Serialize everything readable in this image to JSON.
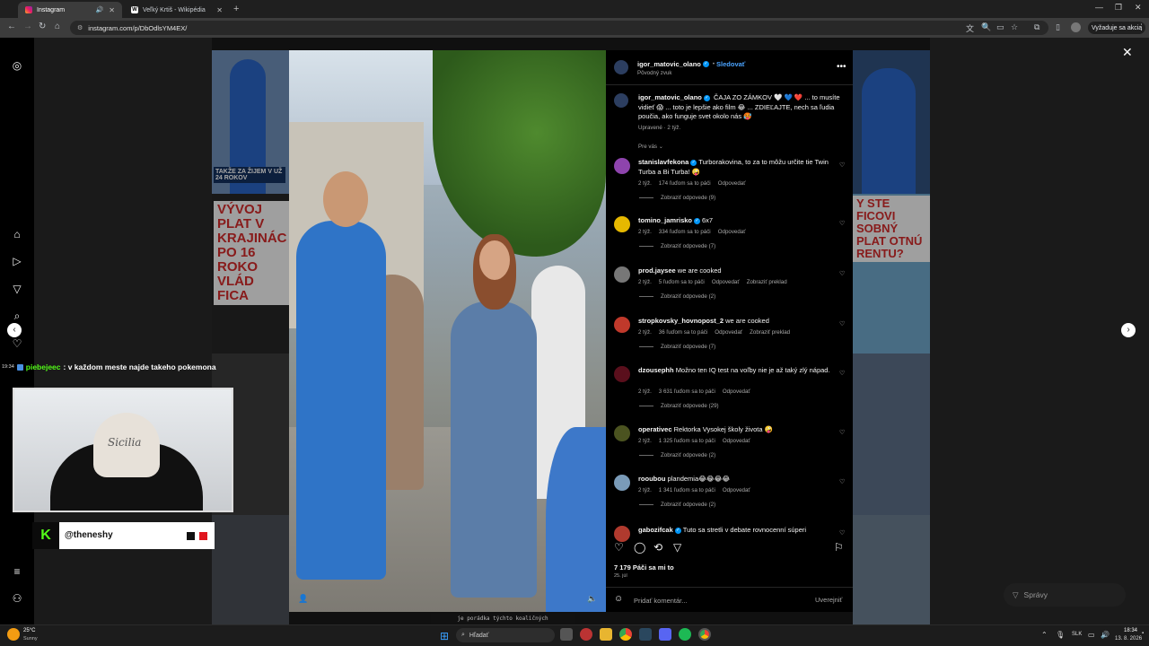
{
  "browser": {
    "tabs": [
      {
        "title": "Instagram",
        "active": true
      },
      {
        "title": "Veľký Krtiš - Wikipédia",
        "active": false
      }
    ],
    "url": "instagram.com/p/DbOdlsYM4EX/",
    "update_label": "Vyžaduje sa akcia"
  },
  "post": {
    "author": "igor_matovic_olano",
    "follow_label": "Sledovať",
    "audio": "Pôvodný zvuk",
    "caption": "ČAJA ZO ZÁMKOV 🤍 💙 ❤️ ... to musíte vidieť 😱 ... toto je lepšie ako film 😂 ... ZDIEĽAJTE, nech sa ľudia poučia, ako funguje svet okolo nás 🥵",
    "caption_meta": "Upravené · 2 týž.",
    "filter_label": "Pre vás",
    "likes": "7 179 Páči sa mi to",
    "date": "25. júl",
    "comment_placeholder": "Pridať komentár...",
    "post_label": "Uverejniť"
  },
  "comments": [
    {
      "user": "stanislavfekona",
      "verified": true,
      "text": "Turborakovina, to za to môžu určite tie Twin Turba a Bi Turba! 🤪",
      "time": "2 týž.",
      "likes": "174 ľuďom sa to páči",
      "reply": "Odpovedať",
      "translate": "",
      "replies": "Zobraziť odpovede (9)",
      "color": "#8e44ad"
    },
    {
      "user": "tomino_jamrisko",
      "verified": true,
      "text": "6x7",
      "time": "2 týž.",
      "likes": "334 ľuďom sa to páči",
      "reply": "Odpovedať",
      "translate": "",
      "replies": "Zobraziť odpovede (7)",
      "color": "#e6b800"
    },
    {
      "user": "prod.jaysee",
      "verified": false,
      "text": "we are cooked",
      "time": "2 týž.",
      "likes": "5 ľuďom sa to páči",
      "reply": "Odpovedať",
      "translate": "Zobraziť preklad",
      "replies": "Zobraziť odpovede (2)",
      "color": "#777777"
    },
    {
      "user": "stropkovsky_hovnopost_2",
      "verified": false,
      "text": "we are cooked",
      "time": "2 týž.",
      "likes": "36 ľuďom sa to páči",
      "reply": "Odpovedať",
      "translate": "Zobraziť preklad",
      "replies": "Zobraziť odpovede (7)",
      "color": "#c0392b"
    },
    {
      "user": "dzousephh",
      "verified": false,
      "text": "Možno ten IQ test na voľby nie je až taký zlý nápad.",
      "time": "2 týž.",
      "likes": "3 631 ľuďom sa to páči",
      "reply": "Odpovedať",
      "translate": "",
      "replies": "Zobraziť odpovede (29)",
      "color": "#5a0f1c"
    },
    {
      "user": "operativec",
      "verified": false,
      "text": "Rektorka Vysokej školy života 🤪",
      "time": "2 týž.",
      "likes": "1 325 ľuďom sa to páči",
      "reply": "Odpovedať",
      "translate": "",
      "replies": "Zobraziť odpovede (2)",
      "color": "#4b5320"
    },
    {
      "user": "rooubou",
      "verified": false,
      "text": "plandemia😂😂😂😂",
      "time": "2 týž.",
      "likes": "1 341 ľuďom sa to páči",
      "reply": "Odpovedať",
      "translate": "",
      "replies": "Zobraziť odpovede (2)",
      "color": "#7a9bb8"
    },
    {
      "user": "gabozifcak",
      "verified": true,
      "text": "Tuto sa stretli v debate rovnocenní súperi",
      "time": "",
      "likes": "",
      "reply": "",
      "translate": "",
      "replies": "",
      "color": "#b03a2e"
    }
  ],
  "background": {
    "banner_left": "VÝVOJ PLAT V KRAJINÁC PO 16 ROKO VLÁD FICA",
    "banner_right": "Y STE FICOVI SOBNÝ PLAT OTNÚ RENTU?",
    "tile_caption": "TAKŽE ZA ŽIJEM V UŽ 24 ROKOV"
  },
  "stream": {
    "chat_time": "19:34",
    "chat_user": "piebejeec",
    "chat_text": ": v každom meste najde takeho pokemona",
    "kick_logo": "K",
    "handle": "@theneshy",
    "cap_text": "Sicilia",
    "subtitle": "je porádka týchto koaličných",
    "spravy": "Správy"
  },
  "taskbar": {
    "temp": "25°C",
    "weather": "Sunny",
    "search": "Hľadať",
    "lang": "SLK",
    "time": "18:34",
    "date": "13. 8. 2026"
  }
}
